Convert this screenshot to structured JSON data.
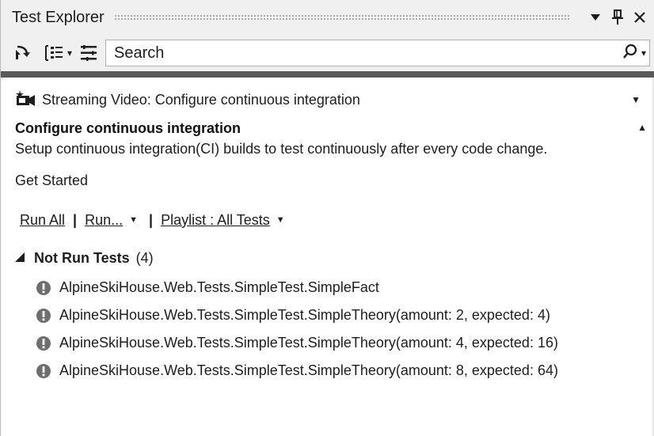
{
  "window": {
    "title": "Test Explorer",
    "controls": {
      "dropdown": "▼",
      "pin": "ᵖ",
      "close": "✕"
    }
  },
  "toolbar": {
    "run_icon": "run-tests-icon",
    "group_icon": "group-by-icon",
    "group_dropdown": "▾",
    "settings_icon": "list-settings-icon",
    "search": {
      "placeholder": "Search",
      "value": ""
    },
    "search_dropdown": "▾"
  },
  "video": {
    "icon": "video-camera-icon",
    "text": "Streaming Video: Configure continuous integration",
    "toggle": "▼"
  },
  "info": {
    "title": "Configure continuous integration",
    "toggle": "▲",
    "description": "Setup continuous integration(CI) builds to test continuously after every code change.",
    "get_started": "Get Started"
  },
  "run_bar": {
    "run_all": "Run All",
    "sep1": "|",
    "run": "Run...",
    "run_caret": "▼",
    "sep2": "|",
    "playlist": "Playlist : All Tests",
    "playlist_caret": "▼"
  },
  "group": {
    "expander": "◢",
    "label": "Not Run Tests",
    "count": "(4)"
  },
  "tests": [
    {
      "name": "AlpineSkiHouse.Web.Tests.SimpleTest.SimpleFact",
      "status_icon": "not-run-icon"
    },
    {
      "name": "AlpineSkiHouse.Web.Tests.SimpleTest.SimpleTheory(amount: 2, expected: 4)",
      "status_icon": "not-run-icon"
    },
    {
      "name": "AlpineSkiHouse.Web.Tests.SimpleTest.SimpleTheory(amount: 4, expected: 16)",
      "status_icon": "not-run-icon"
    },
    {
      "name": "AlpineSkiHouse.Web.Tests.SimpleTest.SimpleTheory(amount: 8, expected: 64)",
      "status_icon": "not-run-icon"
    }
  ],
  "colors": {
    "chrome": "#f0f0f0",
    "divider": "#5a5a5a",
    "text": "#1e1e1e",
    "not_run_icon": "#6e6e6e"
  }
}
